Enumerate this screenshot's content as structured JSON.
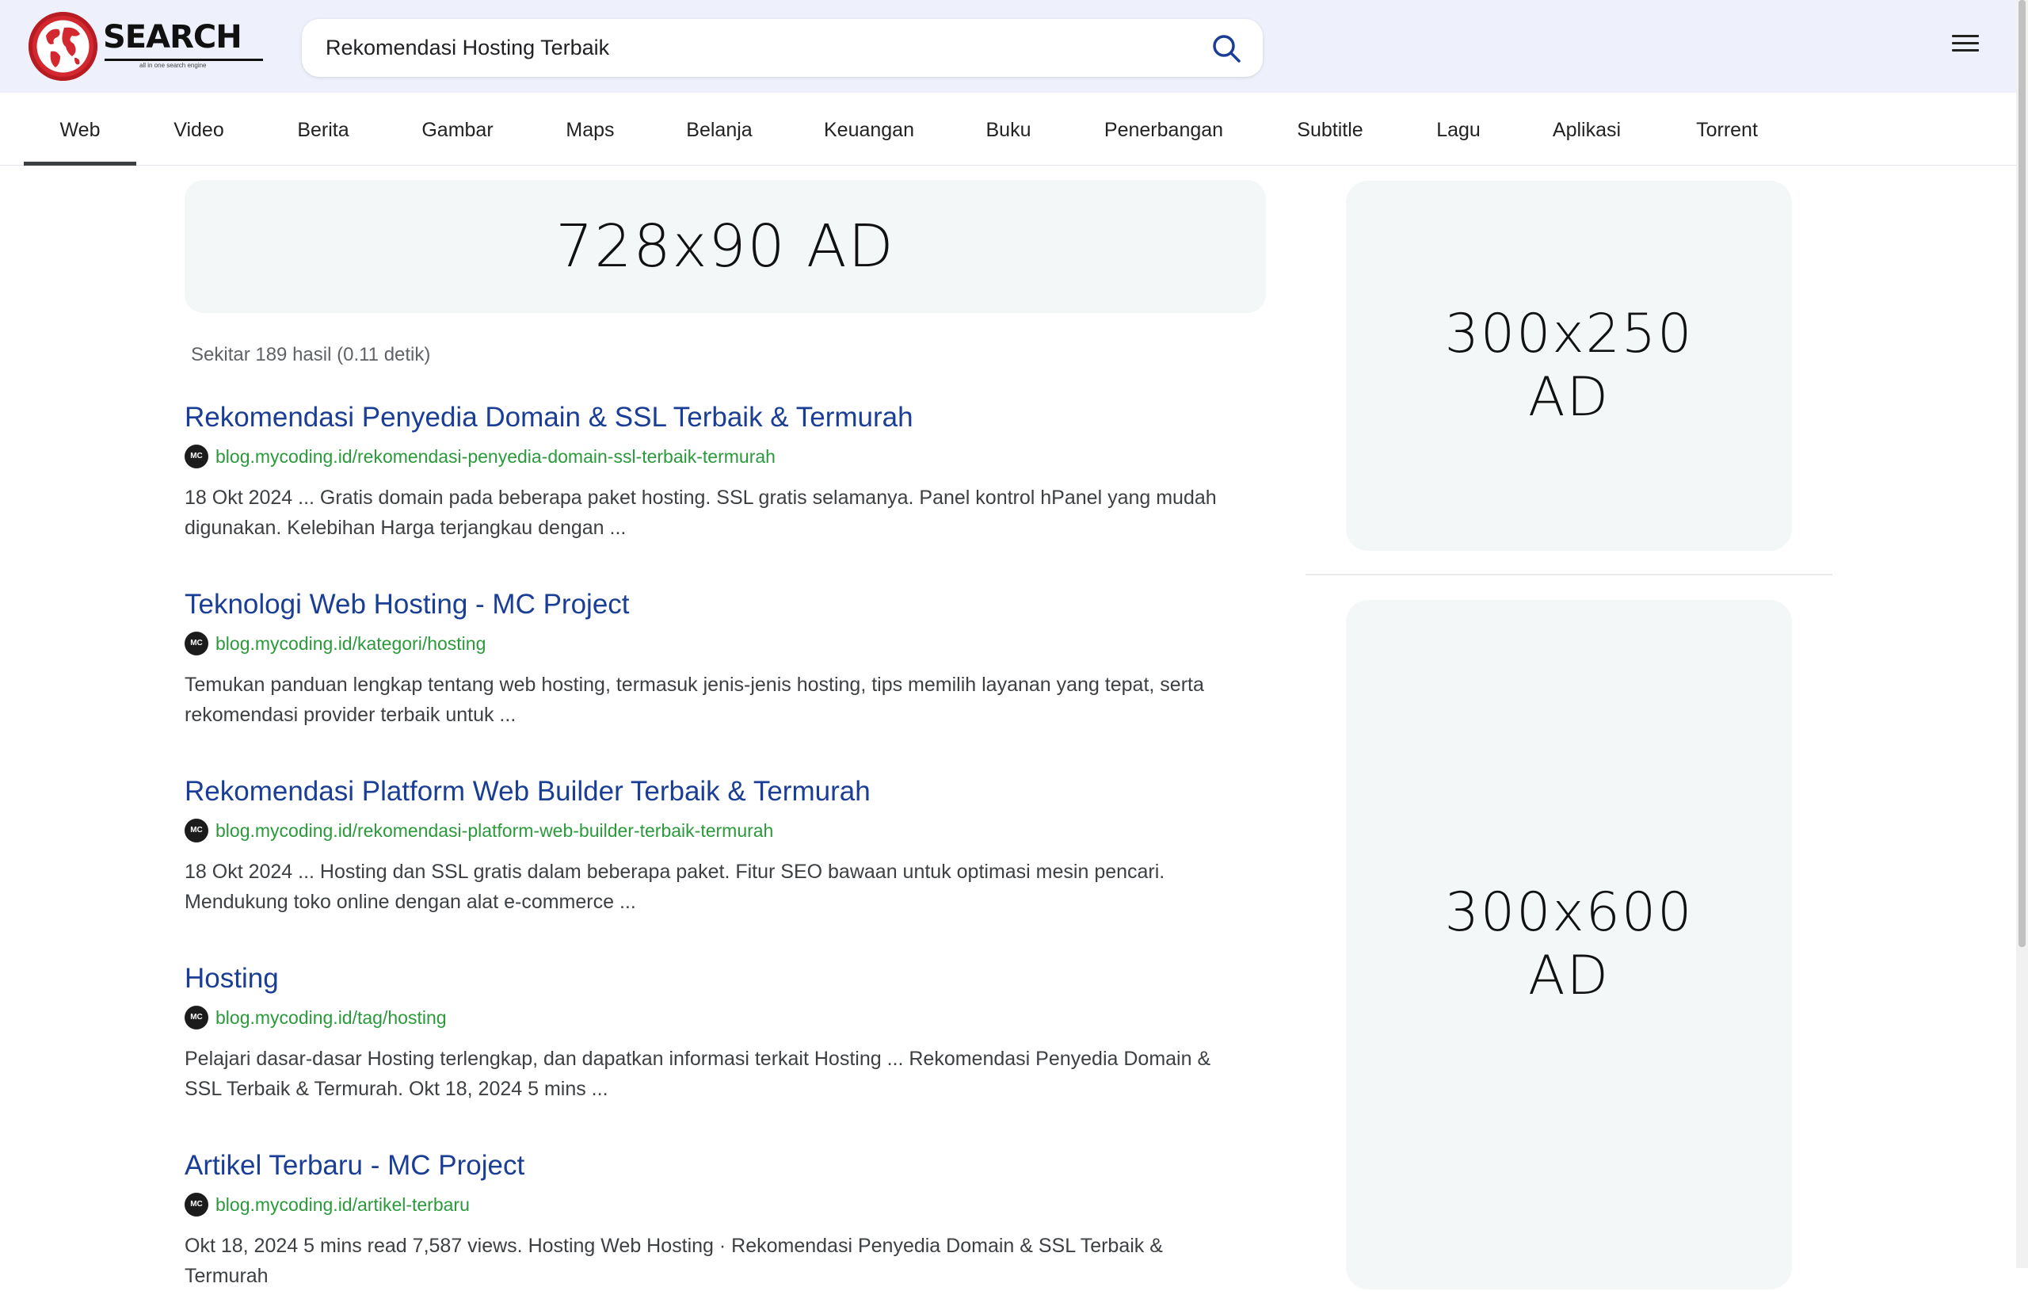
{
  "header": {
    "logo_text": "SEARCH",
    "logo_tagline": "all in one search engine",
    "search_value": "Rekomendasi Hosting Terbaik",
    "search_icon": "search-icon",
    "menu_icon": "hamburger-menu-icon"
  },
  "tabs": [
    {
      "label": "Web",
      "active": true
    },
    {
      "label": "Video"
    },
    {
      "label": "Berita"
    },
    {
      "label": "Gambar"
    },
    {
      "label": "Maps"
    },
    {
      "label": "Belanja"
    },
    {
      "label": "Keuangan"
    },
    {
      "label": "Buku"
    },
    {
      "label": "Penerbangan"
    },
    {
      "label": "Subtitle"
    },
    {
      "label": "Lagu"
    },
    {
      "label": "Aplikasi"
    },
    {
      "label": "Torrent"
    }
  ],
  "ads": {
    "banner": "728x90 AD",
    "side_top_line1": "300x250",
    "side_top_line2": "AD",
    "side_bottom_line1": "300x600",
    "side_bottom_line2": "AD"
  },
  "result_stats": "Sekitar 189 hasil (0.11 detik)",
  "results": [
    {
      "title": "Rekomendasi Penyedia Domain & SSL Terbaik & Termurah",
      "url": "blog.mycoding.id/rekomendasi-penyedia-domain-ssl-terbaik-termurah",
      "snippet": "18 Okt 2024 ... Gratis domain pada beberapa paket hosting. SSL gratis selamanya. Panel kontrol hPanel yang mudah digunakan. Kelebihan Harga terjangkau dengan ..."
    },
    {
      "title": "Teknologi Web Hosting - MC Project",
      "url": "blog.mycoding.id/kategori/hosting",
      "snippet": "Temukan panduan lengkap tentang web hosting, termasuk jenis-jenis hosting, tips memilih layanan yang tepat, serta rekomendasi provider terbaik untuk ..."
    },
    {
      "title": "Rekomendasi Platform Web Builder Terbaik & Termurah",
      "url": "blog.mycoding.id/rekomendasi-platform-web-builder-terbaik-termurah",
      "snippet": "18 Okt 2024 ... Hosting dan SSL gratis dalam beberapa paket. Fitur SEO bawaan untuk optimasi mesin pencari. Mendukung toko online dengan alat e-commerce ..."
    },
    {
      "title": "Hosting",
      "url": "blog.mycoding.id/tag/hosting",
      "snippet": "Pelajari dasar-dasar Hosting terlengkap, dan dapatkan informasi terkait Hosting ... Rekomendasi Penyedia Domain & SSL Terbaik & Termurah. Okt 18, 2024 5 mins ..."
    },
    {
      "title": "Artikel Terbaru - MC Project",
      "url": "blog.mycoding.id/artikel-terbaru",
      "snippet": "Okt 18, 2024 5 mins read 7,587 views. Hosting Web Hosting · Rekomendasi Penyedia Domain & SSL Terbaik & Termurah"
    }
  ],
  "favicon_text": "MC",
  "colors": {
    "header_bg": "#eef0fb",
    "link": "#1a3e96",
    "url": "#2a9a3a",
    "logo_red": "#d3282f"
  }
}
